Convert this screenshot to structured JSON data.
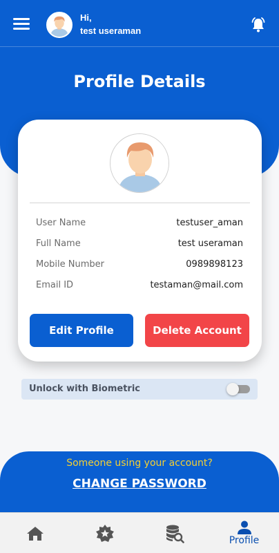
{
  "header": {
    "greeting": "Hi,",
    "username": "test useraman",
    "menu_icon": "hamburger-menu-icon",
    "notification_icon": "bell-icon"
  },
  "page": {
    "title": "Profile Details"
  },
  "profile": {
    "fields": [
      {
        "label": "User Name",
        "value": "testuser_aman"
      },
      {
        "label": "Full Name",
        "value": "test useraman"
      },
      {
        "label": "Mobile Number",
        "value": "0989898123"
      },
      {
        "label": "Email ID",
        "value": "testaman@mail.com"
      }
    ],
    "edit_label": "Edit Profile",
    "delete_label": "Delete Account"
  },
  "biometric": {
    "label": "Unlock with Biometric",
    "enabled": false
  },
  "security": {
    "question": "Someone using your account?",
    "link_label": "CHANGE PASSWORD"
  },
  "tabs": [
    {
      "icon": "home-icon",
      "label": ""
    },
    {
      "icon": "star-badge-icon",
      "label": ""
    },
    {
      "icon": "database-search-icon",
      "label": ""
    },
    {
      "icon": "profile-icon",
      "label": "Profile"
    }
  ],
  "colors": {
    "primary": "#0a5fd1",
    "danger": "#f24548",
    "accent_yellow": "#f5d033"
  }
}
